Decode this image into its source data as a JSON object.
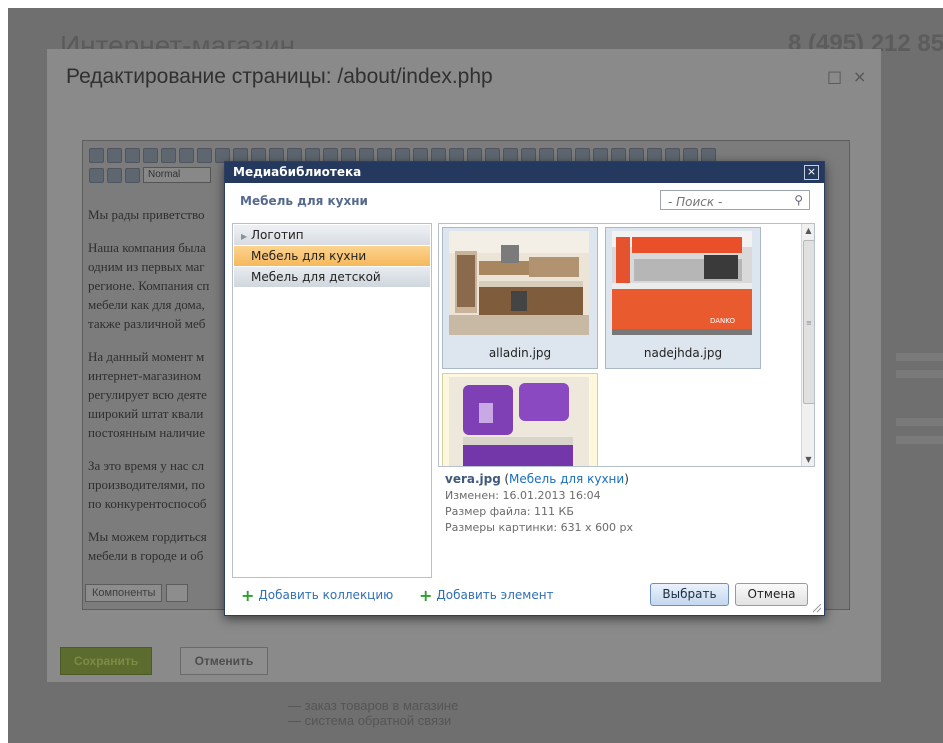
{
  "background": {
    "site_title": "Интернет-магазин",
    "phone": "8 (495) 212 85",
    "bullets": [
      "— заказ товаров в магазине",
      "— система обратной связи"
    ]
  },
  "editor": {
    "title": "Редактирование страницы: /about/index.php",
    "style_select": "Normal",
    "paragraphs": [
      [
        "Мы рады приветство"
      ],
      [
        "Наша компания была",
        "одним из первых маг",
        "регионе. Компания сп",
        "мебели как для дома,",
        "также различной меб"
      ],
      [
        "На данный момент м",
        "интернет-магазином",
        "регулирует всю деяте",
        "широкий штат квали",
        "постоянным наличие"
      ],
      [
        "За это время у нас сл",
        "производителями, по",
        "по конкурентоспособ"
      ],
      [
        "Мы можем гордиться",
        "мебели в городе и об"
      ]
    ],
    "components_tab": "Компоненты",
    "save_label": "Сохранить",
    "cancel_label": "Отменить"
  },
  "medialib": {
    "title": "Медиабиблиотека",
    "current_collection": "Мебель для кухни",
    "search_placeholder": "- Поиск -",
    "collections": [
      {
        "label": "Логотип",
        "has_children": true
      },
      {
        "label": "Мебель для кухни",
        "selected": true
      },
      {
        "label": "Мебель для детской"
      }
    ],
    "items": [
      {
        "name": "alladin.jpg"
      },
      {
        "name": "nadejhda.jpg"
      },
      {
        "name": "vera.jpg",
        "selected": true
      }
    ],
    "info": {
      "name": "vera.jpg",
      "collection": "Мебель для кухни",
      "modified": "Изменен: 16.01.2013 16:04",
      "filesize": "Размер файла: 111 КБ",
      "dimensions": "Размеры картинки: 631 x 600 px"
    },
    "add_collection": "Добавить коллекцию",
    "add_item": "Добавить элемент",
    "choose_label": "Выбрать",
    "cancel_label": "Отмена",
    "close_glyph": "×"
  }
}
